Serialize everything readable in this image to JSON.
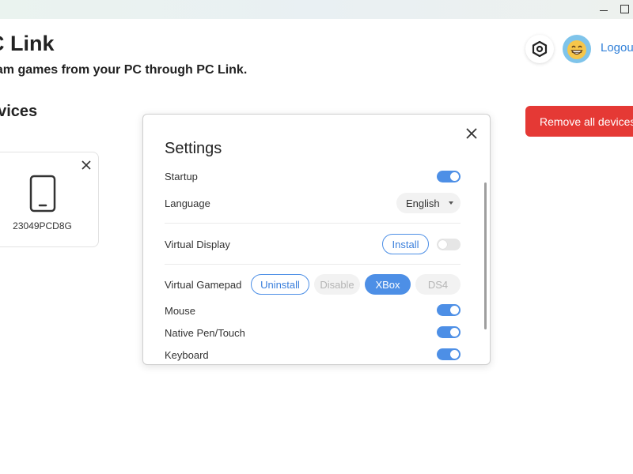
{
  "window": {
    "controls": {
      "minimize_icon": "minimize-icon",
      "maximize_icon": "maximize-icon"
    }
  },
  "header": {
    "title": "C Link",
    "subtitle": "eam games from your PC through PC Link.",
    "logout_label": "Logou",
    "settings_icon": "hexagon-settings-icon",
    "avatar_icon": "grinning-face-avatar"
  },
  "devices": {
    "section_title": "evices",
    "remove_all_label": "Remove all devices",
    "items": [
      {
        "name": "23049PCD8G",
        "icon": "phone-icon"
      }
    ]
  },
  "settings_modal": {
    "title": "Settings",
    "rows": {
      "startup": {
        "label": "Startup",
        "enabled": true
      },
      "language": {
        "label": "Language",
        "value": "English"
      },
      "virtual_display": {
        "label": "Virtual Display",
        "install_label": "Install",
        "enabled": false
      },
      "virtual_gamepad": {
        "label": "Virtual Gamepad",
        "uninstall_label": "Uninstall",
        "disable_label": "Disable",
        "xbox_label": "XBox",
        "ds4_label": "DS4",
        "selected": "XBox"
      },
      "mouse": {
        "label": "Mouse",
        "enabled": true
      },
      "native_pen_touch": {
        "label": "Native Pen/Touch",
        "enabled": true
      },
      "keyboard": {
        "label": "Keyboard",
        "enabled": true
      }
    }
  },
  "colors": {
    "accent": "#4d8fe6",
    "danger": "#e53935",
    "link": "#2f7fd8"
  }
}
